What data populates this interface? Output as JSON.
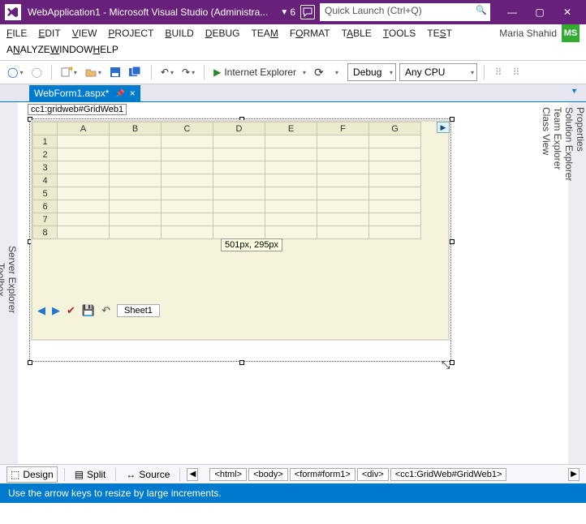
{
  "title": "WebApplication1 - Microsoft Visual Studio (Administra...",
  "notification_count": "6",
  "quick_launch_placeholder": "Quick Launch (Ctrl+Q)",
  "menu": [
    "FILE",
    "EDIT",
    "VIEW",
    "PROJECT",
    "BUILD",
    "DEBUG",
    "TEAM",
    "FORMAT",
    "TABLE",
    "TOOLS",
    "TEST",
    "ANALYZE",
    "WINDOW",
    "HELP"
  ],
  "user_name": "Maria Shahid",
  "user_initials": "MS",
  "toolbar": {
    "browser_label": "Internet Explorer",
    "config": "Debug",
    "platform": "Any CPU"
  },
  "doc_tab": "WebForm1.aspx*",
  "element_path": "cc1:gridweb#GridWeb1",
  "left_rail": [
    "Server Explorer",
    "Toolbox"
  ],
  "right_rail": [
    "Properties",
    "Solution Explorer",
    "Team Explorer",
    "Class View"
  ],
  "grid": {
    "cols": [
      "A",
      "B",
      "C",
      "D",
      "E",
      "F",
      "G"
    ],
    "rows": [
      "1",
      "2",
      "3",
      "4",
      "5",
      "6",
      "7",
      "8"
    ],
    "sheet": "Sheet1"
  },
  "size_tooltip": "501px, 295px",
  "view_modes": {
    "design": "Design",
    "split": "Split",
    "source": "Source"
  },
  "tagpath": [
    "<html>",
    "<body>",
    "<form#form1>",
    "<div>",
    "<cc1:GridWeb#GridWeb1>"
  ],
  "status": "Use the arrow keys to resize by large increments."
}
